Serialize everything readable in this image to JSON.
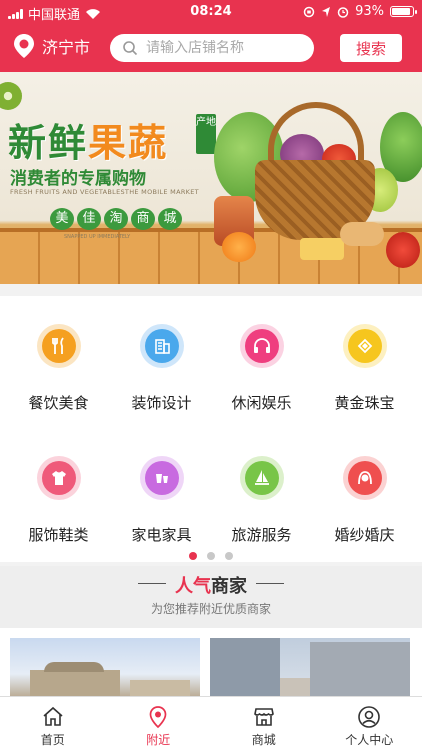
{
  "status_bar": {
    "carrier": "中国联通",
    "time": "08:24",
    "battery_percent": "93%",
    "battery_level": 0.93
  },
  "header": {
    "city": "济宁市",
    "search_placeholder": "请输入店铺名称",
    "search_button": "搜索"
  },
  "banner": {
    "title_part1": "新鲜",
    "title_part2": "果蔬",
    "tag": "产地",
    "subtitle": "消费者的专属购物",
    "english": "FRESH FRUITS AND VEGETABLESTHE MOBILE MARKET",
    "brand": [
      "美",
      "佳",
      "淘",
      "商",
      "城"
    ],
    "small_text": "SNAPPED UP IMMEDIATELY"
  },
  "categories": [
    {
      "label": "餐饮美食",
      "icon": "cutlery-icon",
      "color": "#f5a020"
    },
    {
      "label": "装饰设计",
      "icon": "building-icon",
      "color": "#4aa8ec"
    },
    {
      "label": "休闲娱乐",
      "icon": "headphones-icon",
      "color": "#ef3e7f"
    },
    {
      "label": "黄金珠宝",
      "icon": "gem-icon",
      "color": "#f6c61e"
    },
    {
      "label": "服饰鞋类",
      "icon": "shirt-icon",
      "color": "#ef5a7a"
    },
    {
      "label": "家电家具",
      "icon": "cups-icon",
      "color": "#c86ae0"
    },
    {
      "label": "旅游服务",
      "icon": "sailboat-icon",
      "color": "#78c548"
    },
    {
      "label": "婚纱婚庆",
      "icon": "bride-icon",
      "color": "#ef4f4f"
    }
  ],
  "pager": {
    "pages": 3,
    "current": 1
  },
  "popular": {
    "title_accent": "人气",
    "title_rest": "商家",
    "subtitle": "为您推荐附近优质商家"
  },
  "tabbar": [
    {
      "label": "首页",
      "icon": "home-icon"
    },
    {
      "label": "附近",
      "icon": "location-icon"
    },
    {
      "label": "商城",
      "icon": "store-icon"
    },
    {
      "label": "个人中心",
      "icon": "user-icon"
    }
  ],
  "colors": {
    "brand": "#e8334f"
  }
}
